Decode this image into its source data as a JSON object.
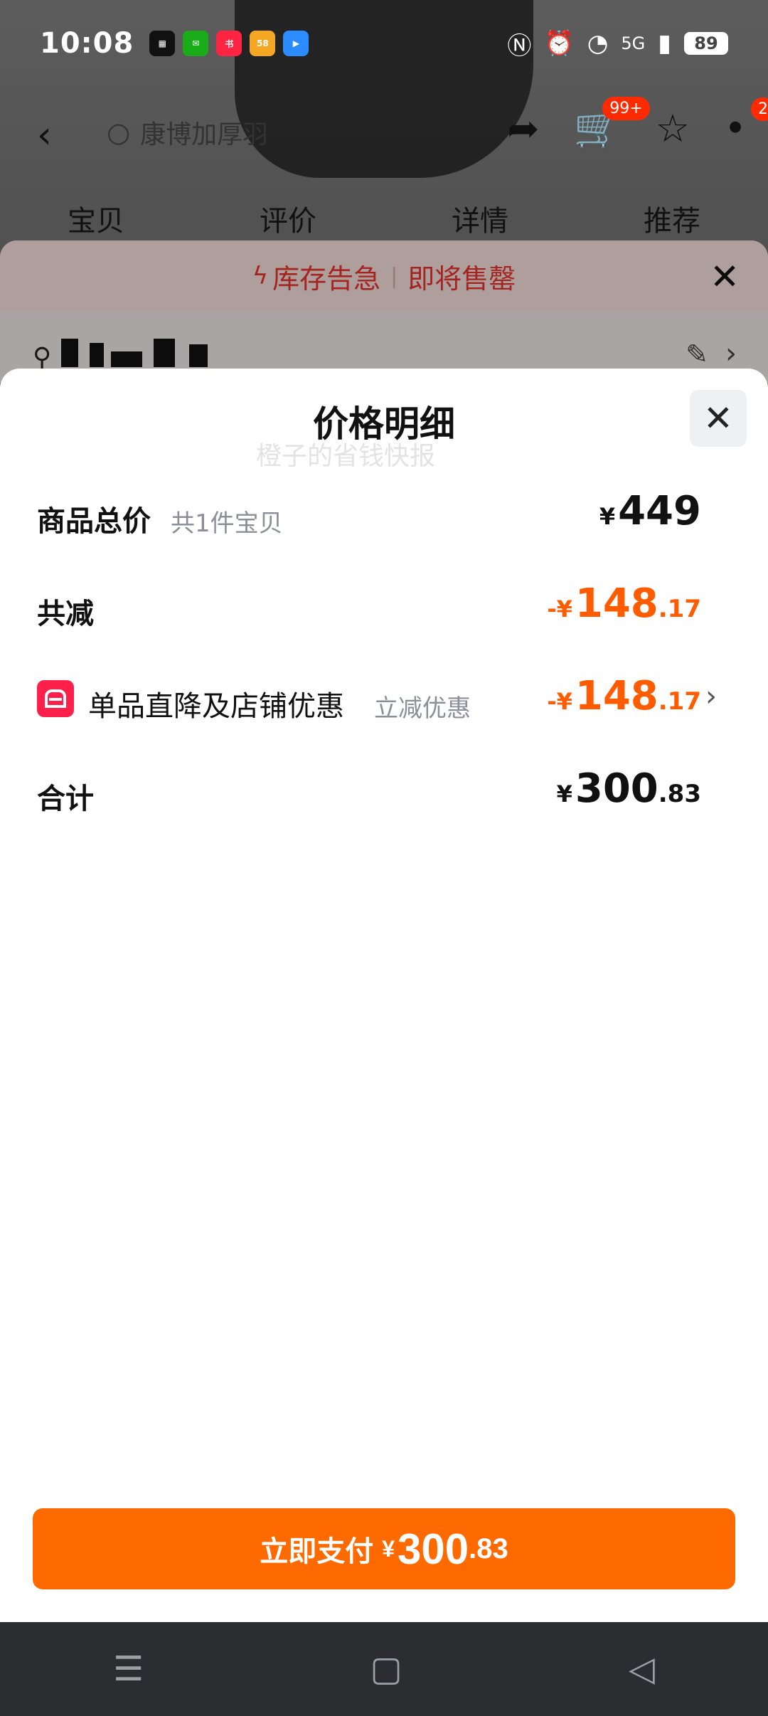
{
  "status_bar": {
    "time": "10:08",
    "battery": "89",
    "network": "5G"
  },
  "background_page": {
    "search_text": "康博加厚羽",
    "cart_badge": "99+",
    "message_badge": "2",
    "tabs": [
      "宝贝",
      "评价",
      "详情",
      "推荐"
    ]
  },
  "stock_banner": {
    "left": "库存告急",
    "right": "即将售罄"
  },
  "price_sheet": {
    "title": "价格明细",
    "items": {
      "label": "商品总价",
      "sub": "共1件宝贝",
      "currency": "¥",
      "amount": "449"
    },
    "total_discount": {
      "label": "共减",
      "prefix": "-¥",
      "amount": "148",
      "decimal": ".17"
    },
    "discount_line": {
      "label": "单品直降及店铺优惠",
      "sub": "立减优惠",
      "prefix": "-¥",
      "amount": "148",
      "decimal": ".17"
    },
    "total": {
      "label": "合计",
      "currency": "¥",
      "amount": "300",
      "decimal": ".83"
    },
    "watermark": "橙子的省钱快报"
  },
  "pay_button": {
    "label": "立即支付",
    "currency": "¥",
    "amount": "300",
    "decimal": ".83"
  },
  "colors": {
    "accent_orange": "#ff6a00",
    "discount_orange": "#ff5b00",
    "shop_icon_red": "#ff1f4b",
    "stock_red": "#e5322d"
  }
}
